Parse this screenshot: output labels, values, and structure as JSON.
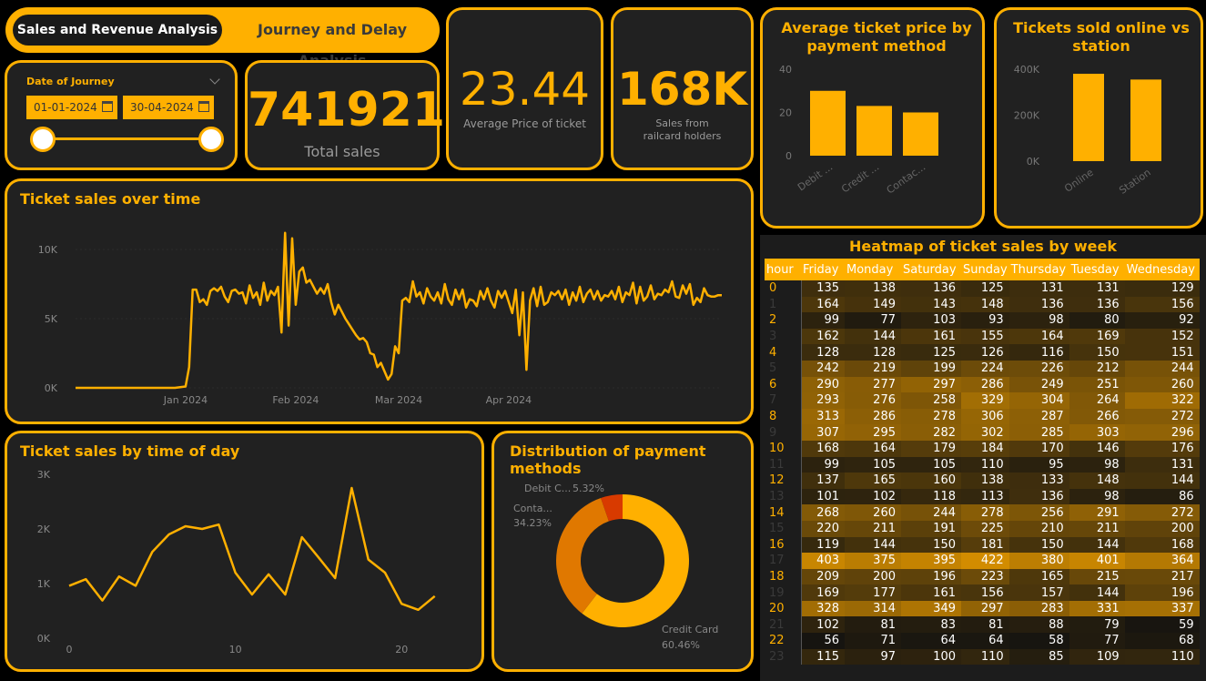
{
  "tabs": {
    "active": "Sales and Revenue Analysis",
    "inactive": "Journey and Delay Analysis"
  },
  "slicer": {
    "label": "Date of Journey",
    "start": "01-01-2024",
    "end": "30-04-2024",
    "start_pct": 0,
    "end_pct": 100
  },
  "kpis": [
    {
      "value": "741921",
      "label": "Total sales"
    },
    {
      "value": "23.44",
      "label": "Average Price of ticket"
    },
    {
      "value": "168K",
      "label": "Sales from railcard holders"
    }
  ],
  "colors": {
    "accent": "#ffb000",
    "card_bg": "#212121",
    "orange": "#e07800",
    "red": "#d83a00"
  },
  "avg_price_chart": {
    "title": "Average ticket price by payment method",
    "chart_data": {
      "type": "bar",
      "categories": [
        "Debit ...",
        "Credit ...",
        "Contac..."
      ],
      "values": [
        30,
        23,
        20
      ],
      "ylim": [
        0,
        40
      ],
      "yticks": [
        "0",
        "20",
        "40"
      ]
    }
  },
  "online_chart": {
    "title": "Tickets sold online vs station",
    "chart_data": {
      "type": "bar",
      "categories": [
        "Online",
        "Station"
      ],
      "values": [
        380000,
        355000
      ],
      "ylim": [
        0,
        400000
      ],
      "yticks": [
        "0K",
        "200K",
        "400K"
      ]
    }
  },
  "over_time_chart": {
    "title": "Ticket sales over time",
    "chart_data": {
      "type": "line",
      "xlim": [
        0,
        118
      ],
      "ylim": [
        0,
        10000
      ],
      "xticks": [
        {
          "at": 31,
          "label": "Jan 2024"
        },
        {
          "at": 62,
          "label": "Feb 2024"
        },
        {
          "at": 91,
          "label": "Mar 2024"
        },
        {
          "at": 122,
          "label": "Apr 2024"
        }
      ],
      "yticks": [
        "0K",
        "5K",
        "10K"
      ],
      "x": [
        0,
        20,
        28,
        31,
        32,
        33,
        34,
        35,
        36,
        37,
        38,
        39,
        40,
        41,
        42,
        43,
        44,
        45,
        46,
        47,
        48,
        49,
        50,
        51,
        52,
        53,
        54,
        55,
        56,
        57,
        58,
        59,
        60,
        61,
        62,
        63,
        64,
        65,
        66,
        67,
        68,
        69,
        70,
        71,
        72,
        73,
        74,
        75,
        76,
        77,
        78,
        79,
        80,
        81,
        82,
        83,
        84,
        85,
        86,
        87,
        88,
        89,
        90,
        91,
        92,
        93,
        94,
        95,
        96,
        97,
        98,
        99,
        100,
        101,
        102,
        103,
        104,
        105,
        106,
        107,
        108,
        109,
        110,
        111,
        112,
        113,
        114,
        115,
        116,
        117,
        118,
        119,
        120,
        121,
        122,
        123,
        124,
        125,
        126,
        127,
        128,
        129,
        130,
        131,
        132,
        133,
        134,
        135,
        136,
        137,
        138,
        139,
        140,
        141,
        142,
        143,
        144,
        145,
        146,
        147,
        148,
        149,
        150,
        151,
        152,
        153,
        154,
        155,
        156,
        157,
        158,
        159,
        160,
        161,
        162,
        163,
        164,
        165,
        166,
        167,
        168,
        169,
        170,
        171,
        172,
        173,
        174,
        175,
        176,
        177,
        178,
        179,
        180,
        181,
        182
      ],
      "y": [
        0,
        0,
        0,
        100,
        1500,
        7100,
        7100,
        6200,
        6400,
        6000,
        7000,
        7200,
        7000,
        7300,
        6600,
        6200,
        7000,
        7100,
        6800,
        6900,
        6100,
        7400,
        6500,
        6900,
        6000,
        7600,
        6300,
        7000,
        6700,
        7300,
        4000,
        11200,
        4500,
        10800,
        6000,
        8400,
        8700,
        7600,
        7800,
        7300,
        6800,
        7200,
        6800,
        7500,
        6200,
        5300,
        6000,
        5500,
        5000,
        4600,
        4200,
        3800,
        3500,
        3600,
        3300,
        2500,
        2400,
        1500,
        1800,
        1200,
        600,
        1000,
        3000,
        2500,
        6300,
        6500,
        6200,
        7700,
        6600,
        6900,
        6100,
        7200,
        6600,
        6300,
        6900,
        6100,
        7500,
        6400,
        6000,
        7100,
        6400,
        7100,
        5800,
        6400,
        6300,
        5900,
        7000,
        6400,
        7200,
        6300,
        5800,
        7000,
        6500,
        7000,
        6200,
        5400,
        7100,
        3800,
        6900,
        1300,
        6300,
        7200,
        5900,
        7300,
        6000,
        6200,
        6900,
        6700,
        7000,
        6400,
        7100,
        6000,
        6900,
        6300,
        7300,
        6200,
        6800,
        7100,
        6400,
        7000,
        6300,
        6700,
        6600,
        7000,
        6400,
        7300,
        6200,
        6900,
        6700,
        7600,
        6100,
        7300,
        6300,
        6600,
        7400,
        6400,
        6800,
        6700,
        7100,
        6900,
        7700,
        6600,
        6500,
        7400,
        6800,
        7500,
        6000,
        6500,
        6200,
        7200,
        6700,
        6600,
        6600,
        6700,
        6700,
        7100,
        6800,
        6600,
        6300,
        6900,
        6000,
        3700
      ]
    }
  },
  "time_of_day_chart": {
    "title": "Ticket sales by time of day",
    "chart_data": {
      "type": "line",
      "x": [
        0,
        1,
        2,
        3,
        4,
        5,
        6,
        7,
        8,
        9,
        10,
        11,
        12,
        13,
        14,
        15,
        16,
        17,
        18,
        19,
        20,
        21,
        22,
        23
      ],
      "y": [
        960,
        1080,
        690,
        1130,
        960,
        1580,
        1900,
        2050,
        2000,
        2080,
        1200,
        800,
        1170,
        800,
        1850,
        1480,
        1100,
        2750,
        1440,
        1200,
        630,
        520,
        770,
        null
      ],
      "xlim": [
        0,
        23
      ],
      "ylim": [
        0,
        3000
      ],
      "xticks": [
        "0",
        "10",
        "20"
      ],
      "yticks": [
        "0K",
        "1K",
        "2K",
        "3K"
      ]
    }
  },
  "payment_chart": {
    "title": "Distribution of payment methods",
    "chart_data": {
      "type": "pie",
      "slices": [
        {
          "label": "Credit Card",
          "pct": 60.46,
          "display": "60.46%",
          "color": "#ffb000"
        },
        {
          "label": "Conta...",
          "pct": 34.23,
          "display": "34.23%",
          "color": "#e07800"
        },
        {
          "label": "Debit C...",
          "pct": 5.32,
          "display": "5.32%",
          "color": "#d83a00"
        }
      ]
    }
  },
  "heatmap": {
    "title": "Heatmap of ticket sales by week",
    "columns": [
      "hour",
      "Friday",
      "Monday",
      "Saturday",
      "Sunday",
      "Thursday",
      "Tuesday",
      "Wednesday"
    ],
    "hour_labels": [
      "0",
      "1",
      "2",
      "3",
      "4",
      "5",
      "6",
      "7",
      "8",
      "9",
      "10",
      "11",
      "12",
      "13",
      "14",
      "15",
      "16",
      "17",
      "18",
      "19",
      "20",
      "21",
      "22",
      "23"
    ],
    "rows": [
      [
        135,
        138,
        136,
        125,
        131,
        131,
        129
      ],
      [
        164,
        149,
        143,
        148,
        136,
        136,
        156
      ],
      [
        99,
        77,
        103,
        93,
        98,
        80,
        92
      ],
      [
        162,
        144,
        161,
        155,
        164,
        169,
        152
      ],
      [
        128,
        128,
        125,
        126,
        116,
        150,
        151
      ],
      [
        242,
        219,
        199,
        224,
        226,
        212,
        244
      ],
      [
        290,
        277,
        297,
        286,
        249,
        251,
        260
      ],
      [
        293,
        276,
        258,
        329,
        304,
        264,
        322
      ],
      [
        313,
        286,
        278,
        306,
        287,
        266,
        272
      ],
      [
        307,
        295,
        282,
        302,
        285,
        303,
        296
      ],
      [
        168,
        164,
        179,
        184,
        170,
        146,
        176
      ],
      [
        99,
        105,
        105,
        110,
        95,
        98,
        131
      ],
      [
        137,
        165,
        160,
        138,
        133,
        148,
        144
      ],
      [
        101,
        102,
        118,
        113,
        136,
        98,
        86
      ],
      [
        268,
        260,
        244,
        278,
        256,
        291,
        272
      ],
      [
        220,
        211,
        191,
        225,
        210,
        211,
        200
      ],
      [
        119,
        144,
        150,
        181,
        150,
        144,
        168
      ],
      [
        403,
        375,
        395,
        422,
        380,
        401,
        364
      ],
      [
        209,
        200,
        196,
        223,
        165,
        215,
        217
      ],
      [
        169,
        177,
        161,
        156,
        157,
        144,
        196
      ],
      [
        328,
        314,
        349,
        297,
        283,
        331,
        337
      ],
      [
        102,
        81,
        83,
        81,
        88,
        79,
        59
      ],
      [
        56,
        71,
        64,
        64,
        58,
        77,
        68
      ],
      [
        115,
        97,
        100,
        110,
        85,
        109,
        110
      ]
    ]
  }
}
